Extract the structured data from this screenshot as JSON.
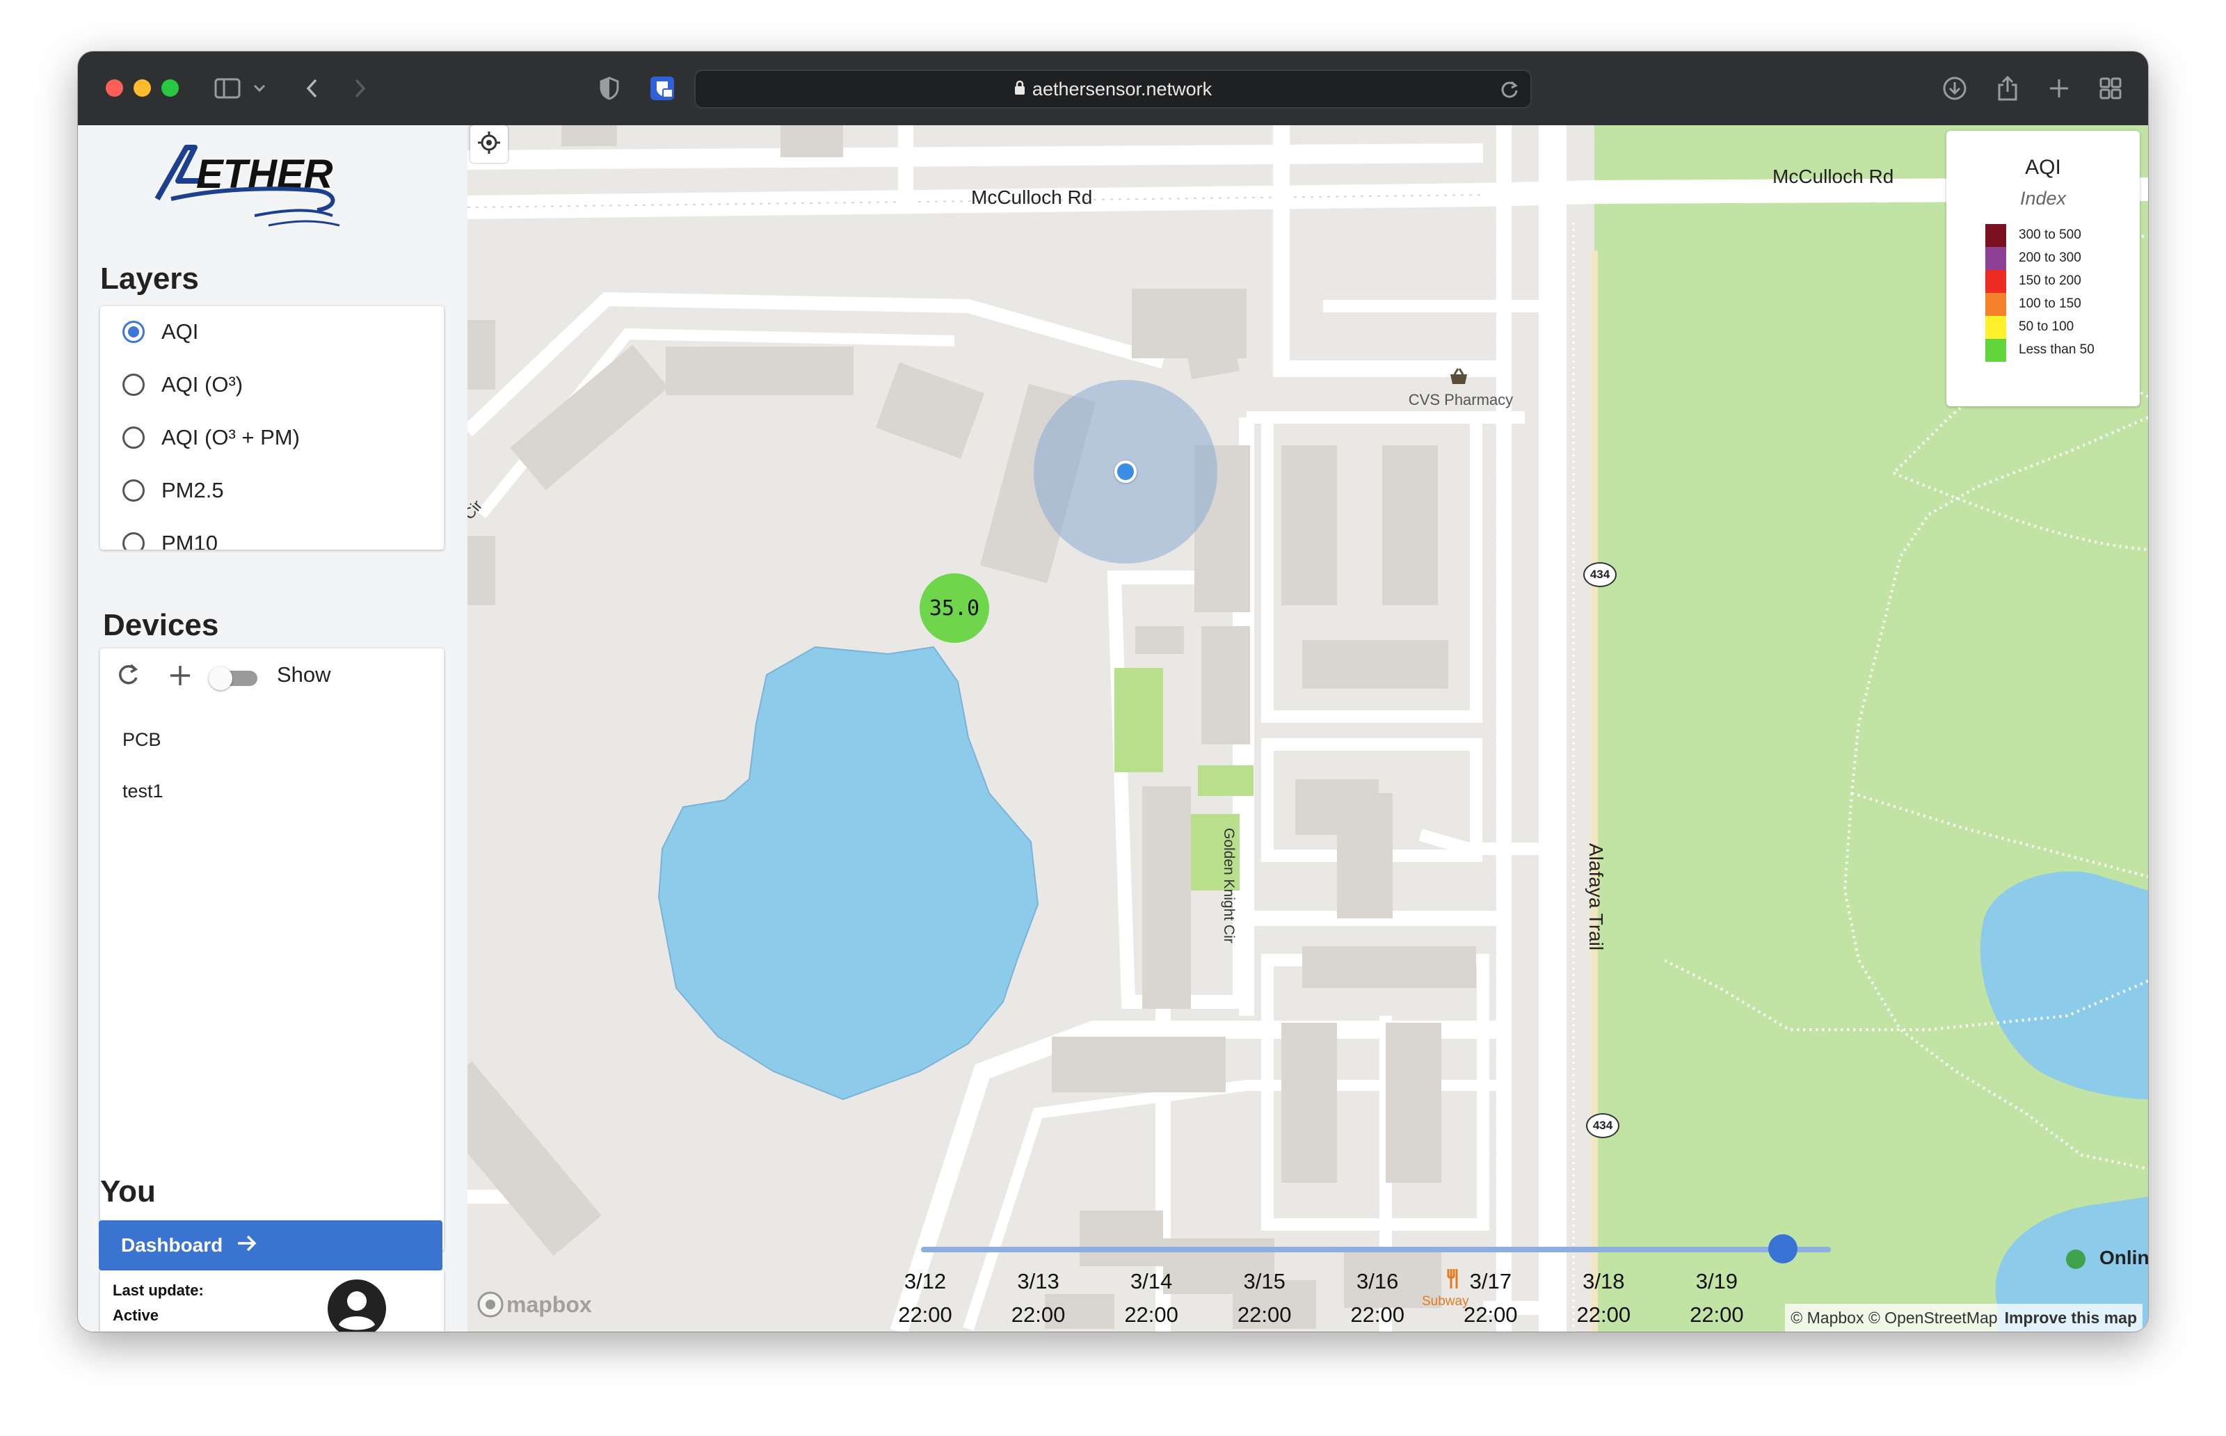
{
  "browser": {
    "url": "aethersensor.network"
  },
  "sidebar": {
    "logo_text": "ETHER",
    "layers_title": "Layers",
    "layers": [
      {
        "label": "AQI",
        "selected": true
      },
      {
        "label": "AQI (O³)",
        "selected": false
      },
      {
        "label": "AQI (O³ + PM)",
        "selected": false
      },
      {
        "label": "PM2.5",
        "selected": false
      },
      {
        "label": "PM10",
        "selected": false
      }
    ],
    "devices_title": "Devices",
    "show_label": "Show",
    "show_toggle_on": false,
    "devices": [
      "PCB",
      "test1"
    ],
    "you_title": "You",
    "dashboard_label": "Dashboard",
    "last_update_label": "Last update:",
    "status_label": "Active"
  },
  "map": {
    "street_labels": {
      "mcculloch_left": "McCulloch Rd",
      "mcculloch_right": "McCulloch Rd",
      "golden_knight": "Golden Knight Cir",
      "alafaya": "Alafaya Trail",
      "cir": "Cir"
    },
    "poi_cvs": "CVS Pharmacy",
    "poi_subway": "Subway",
    "route_shield": "434",
    "sensor_value": "35.0",
    "sensor_color": "#6fd64c",
    "mapbox_logo": "mapbox",
    "attribution": "© Mapbox © OpenStreetMap",
    "improve_link": "Improve this map",
    "online_label": "Online",
    "online_color": "#3fa34d"
  },
  "legend": {
    "title": "AQI",
    "subtitle": "Index",
    "items": [
      {
        "label": "300 to 500",
        "color": "#7a1020"
      },
      {
        "label": "200 to 300",
        "color": "#8e3f96"
      },
      {
        "label": "150 to 200",
        "color": "#ee2c24"
      },
      {
        "label": "100 to 150",
        "color": "#f5812a"
      },
      {
        "label": "50 to 100",
        "color": "#fff22c"
      },
      {
        "label": "Less than 50",
        "color": "#61d33b"
      }
    ]
  },
  "timeline": {
    "ticks": [
      {
        "date": "3/12",
        "time": "22:00"
      },
      {
        "date": "3/13",
        "time": "22:00"
      },
      {
        "date": "3/14",
        "time": "22:00"
      },
      {
        "date": "3/15",
        "time": "22:00"
      },
      {
        "date": "3/16",
        "time": "22:00"
      },
      {
        "date": "3/17",
        "time": "22:00"
      },
      {
        "date": "3/18",
        "time": "22:00"
      },
      {
        "date": "3/19",
        "time": "22:00"
      }
    ],
    "slider_position_fraction": 0.947
  }
}
